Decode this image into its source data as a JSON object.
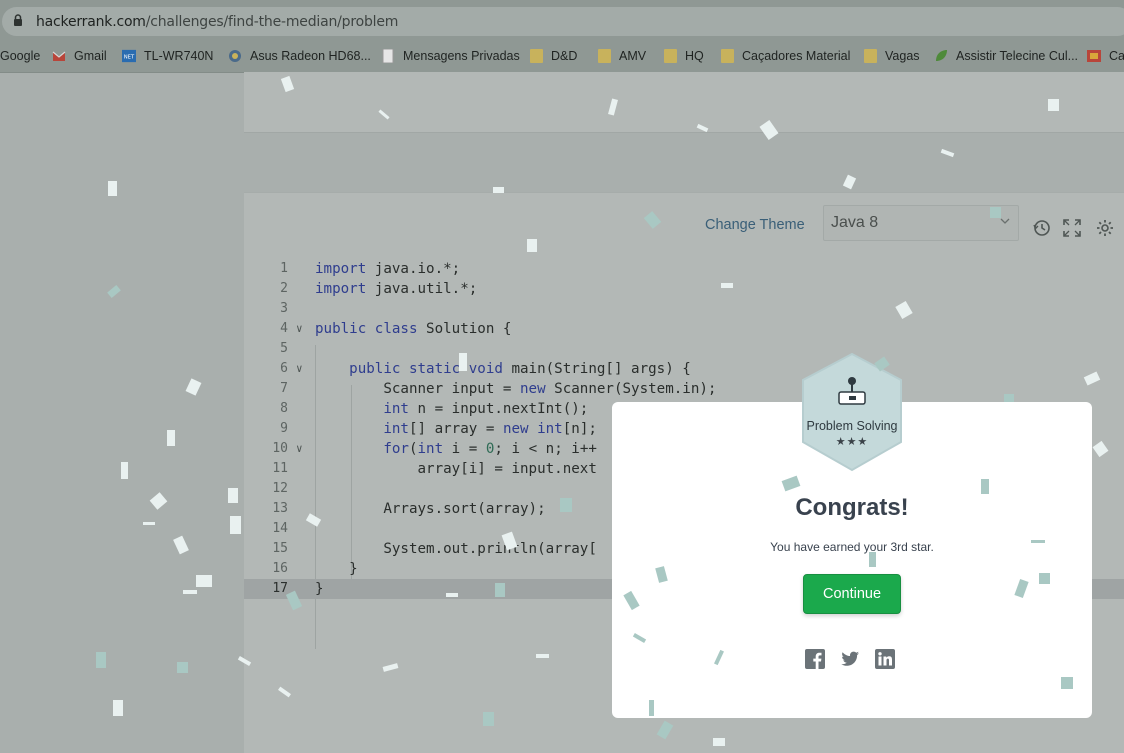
{
  "browser": {
    "url_host": "hackerrank.com",
    "url_path": "/challenges/find-the-median/problem",
    "bookmarks": [
      {
        "label": "Google",
        "icon": "google-icon"
      },
      {
        "label": "Gmail",
        "icon": "gmail-icon"
      },
      {
        "label": "TL-WR740N",
        "icon": "net-icon"
      },
      {
        "label": "Asus Radeon HD68...",
        "icon": "asus-icon"
      },
      {
        "label": "Mensagens Privadas",
        "icon": "page-icon"
      },
      {
        "label": "D&D",
        "icon": "folder-icon"
      },
      {
        "label": "AMV",
        "icon": "folder-icon"
      },
      {
        "label": "HQ",
        "icon": "folder-icon"
      },
      {
        "label": "Caçadores Material",
        "icon": "folder-icon"
      },
      {
        "label": "Vagas",
        "icon": "folder-icon"
      },
      {
        "label": "Assistir Telecine Cul...",
        "icon": "leaf-icon"
      },
      {
        "label": "Ca",
        "icon": "flag-icon"
      }
    ]
  },
  "editor": {
    "change_theme_label": "Change Theme",
    "language": "Java 8",
    "lines": [
      {
        "n": "1",
        "text": "import java.io.*;"
      },
      {
        "n": "2",
        "text": "import java.util.*;"
      },
      {
        "n": "3",
        "text": ""
      },
      {
        "n": "4",
        "text": "public class Solution {"
      },
      {
        "n": "5",
        "text": ""
      },
      {
        "n": "6",
        "text": "    public static void main(String[] args) {"
      },
      {
        "n": "7",
        "text": "        Scanner input = new Scanner(System.in);"
      },
      {
        "n": "8",
        "text": "        int n = input.nextInt();"
      },
      {
        "n": "9",
        "text": "        int[] array = new int[n];"
      },
      {
        "n": "10",
        "text": "        for(int i = 0; i < n; i++"
      },
      {
        "n": "11",
        "text": "            array[i] = input.next"
      },
      {
        "n": "12",
        "text": ""
      },
      {
        "n": "13",
        "text": "        Arrays.sort(array);"
      },
      {
        "n": "14",
        "text": ""
      },
      {
        "n": "15",
        "text": "        System.out.println(array["
      },
      {
        "n": "16",
        "text": "    }"
      },
      {
        "n": "17",
        "text": "}"
      }
    ]
  },
  "modal": {
    "badge_label": "Problem Solving",
    "badge_stars": "★★★",
    "title": "Congrats!",
    "subtitle": "You have earned your 3rd star.",
    "continue_label": "Continue",
    "share": [
      "facebook-icon",
      "twitter-icon",
      "linkedin-icon"
    ]
  },
  "colors": {
    "continue_button": "#1ba94c",
    "modal_bg": "#ffffff",
    "overlay": "#a9afad"
  }
}
